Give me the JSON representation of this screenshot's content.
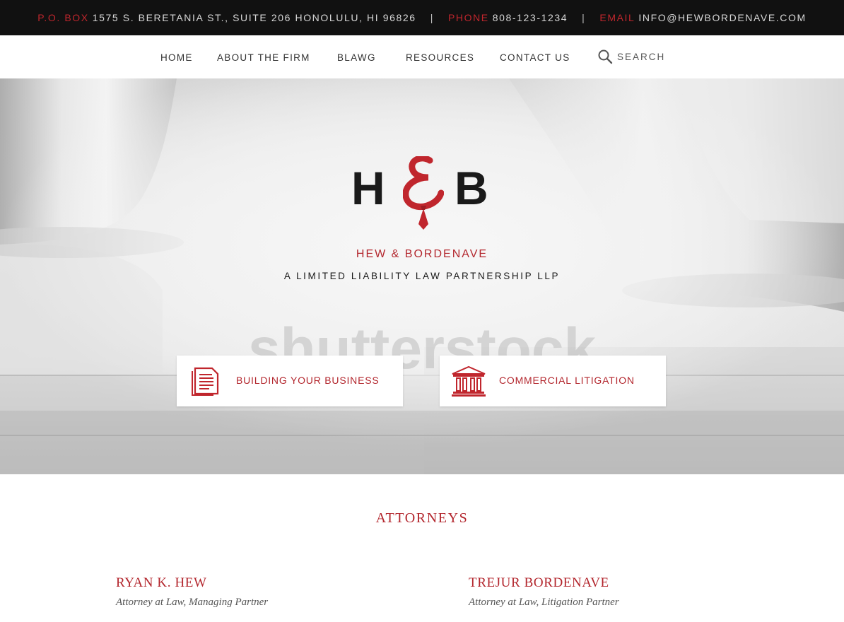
{
  "topbar": {
    "po_box_label": "P.O. BOX",
    "address": "1575 S. BERETANIA ST., SUITE 206 HONOLULU, HI 96826",
    "separator": "|",
    "phone_label": "PHONE",
    "phone": "808-123-1234",
    "email_label": "EMAIL",
    "email": "INFO@HEWBORDENAVE.COM"
  },
  "nav": {
    "items": [
      {
        "label": "HOME"
      },
      {
        "label": "ABOUT THE FIRM"
      },
      {
        "label": "BLAWG"
      },
      {
        "label": "RESOURCES"
      },
      {
        "label": "CONTACT US"
      }
    ],
    "search": {
      "placeholder": "SEARCH",
      "icon": "search-icon"
    }
  },
  "hero": {
    "logo": {
      "letter_left": "H",
      "letter_right": "B",
      "amp_icon": "ampersand-necktie-icon",
      "firm_name": "HEW & BORDENAVE",
      "tagline": "A LIMITED LIABILITY LAW PARTNERSHIP LLP"
    },
    "watermark": "shutterstock",
    "cta": [
      {
        "label": "BUILDING YOUR BUSINESS",
        "icon": "document-icon"
      },
      {
        "label": "COMMERCIAL LITIGATION",
        "icon": "courthouse-icon"
      }
    ]
  },
  "attorneys": {
    "heading": "ATTORNEYS",
    "people": [
      {
        "name": "RYAN K. HEW",
        "title": "Attorney at Law, Managing Partner"
      },
      {
        "name": "TREJUR BORDENAVE",
        "title": "Attorney at Law, Litigation Partner"
      }
    ]
  },
  "colors": {
    "accent_red": "#b3262d",
    "topbar_bg": "#111111",
    "text_dark": "#1a1a1a"
  }
}
